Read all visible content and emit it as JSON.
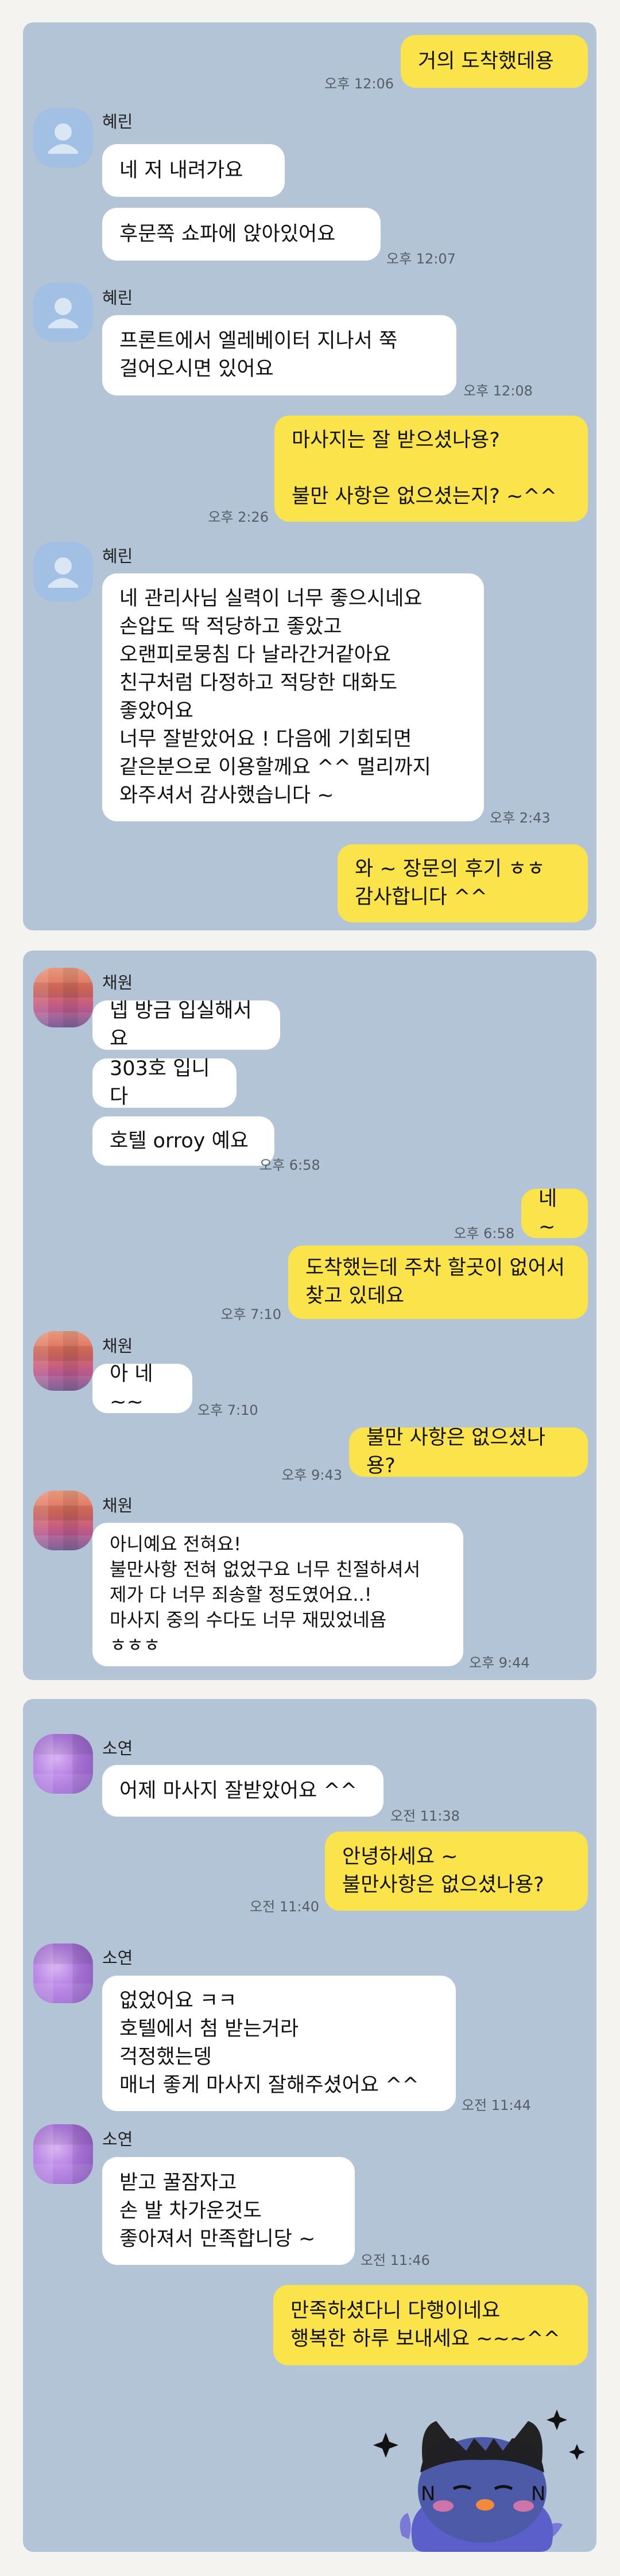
{
  "panel1": {
    "messages": [
      {
        "text": "거의 도착했데용",
        "time": "오후 12:06"
      },
      {
        "sender": "혜린",
        "text": "네 저 내려가요"
      },
      {
        "text": "후문쪽 쇼파에 앉아있어요",
        "time": "오후 12:07"
      },
      {
        "sender": "혜린",
        "text": "프론트에서 엘레베이터 지나서 쭉\n걸어오시면 있어요",
        "time": "오후 12:08"
      },
      {
        "text": "마사지는 잘 받으셨나용?\n\n불만 사항은 없으셨는지? ~^^",
        "time": "오후 2:26"
      },
      {
        "sender": "혜린",
        "text": "네 관리사님 실력이 너무 좋으시네요\n손압도 딱 적당하고 좋았고\n오랜피로뭉침 다 날라간거같아요\n친구처럼 다정하고 적당한 대화도\n좋았어요\n너무 잘받았어요 ! 다음에 기회되면\n같은분으로 이용할께요 ^^ 멀리까지\n와주셔서 감사했습니다 ~",
        "time": "오후 2:43"
      },
      {
        "text": "와 ~ 장문의 후기 ㅎㅎ\n감사합니다 ^^"
      }
    ]
  },
  "panel2": {
    "messages": [
      {
        "sender": "채원",
        "text": "넵 방금 입실해서요"
      },
      {
        "text": "303호 입니다"
      },
      {
        "text": "호텔 orroy 예요",
        "time": "오후 6:58"
      },
      {
        "text": "네 ~",
        "time": "오후 6:58"
      },
      {
        "text": "도착했는데  주차 할곳이 없어서\n찾고 있데요",
        "time": "오후 7:10"
      },
      {
        "sender": "채원",
        "text": "아 네~~",
        "time": "오후 7:10"
      },
      {
        "text": "불만 사항은 없으셨나용?",
        "time": "오후 9:43"
      },
      {
        "sender": "채원",
        "text": "아니예요 전혀요!\n불만사항 전혀 없었구요 너무 친절하셔서\n제가 다 너무 죄송할 정도였어요..!\n마사지 중의 수다도 너무 재밌었네욤\nㅎㅎㅎ",
        "time": "오후 9:44"
      }
    ]
  },
  "panel3": {
    "messages": [
      {
        "sender": "소연",
        "text": "어제 마사지 잘받았어요 ^^",
        "time": "오전 11:38"
      },
      {
        "text": "안녕하세요 ~\n불만사항은 없으셨나용?",
        "time": "오전 11:40"
      },
      {
        "sender": "소연",
        "text": "없었어요 ㅋㅋ\n호텔에서 첨 받는거라\n걱정했는뎅\n매너 좋게 마사지 잘해주셨어요 ^^",
        "time": "오전 11:44"
      },
      {
        "sender": "소연",
        "text": "받고 꿀잠자고\n손 발 차가운것도\n좋아져서 만족합니당 ~",
        "time": "오전 11:46"
      },
      {
        "text": "만족하셨다니 다행이네요\n행복한 하루 보내세요 ~~~^^"
      }
    ]
  },
  "sticker": {
    "icon": "kakao-friend-sticker-icon"
  },
  "colors": {
    "mine": "#fbe34b",
    "theirs": "#ffffff",
    "panel": "#b3c4d6",
    "page": "#f5f3ef"
  }
}
